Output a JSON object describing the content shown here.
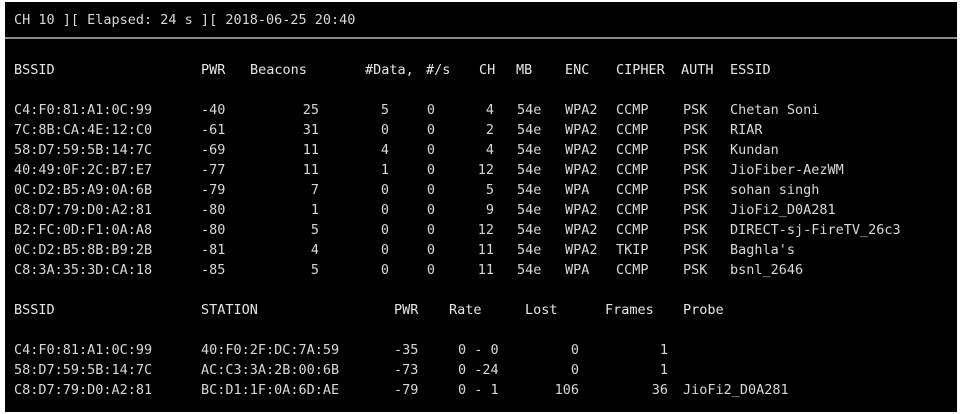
{
  "header": {
    "status_line": "CH 10 ][ Elapsed: 24 s ][ 2018-06-25 20:40"
  },
  "ap_table": {
    "headers": {
      "bssid": "BSSID",
      "pwr": "PWR",
      "beacons": "Beacons",
      "data": "#Data,",
      "rate": "#/s",
      "ch": "CH",
      "mb": "MB",
      "enc": "ENC",
      "cipher": "CIPHER",
      "auth": "AUTH",
      "essid": "ESSID"
    },
    "rows": [
      {
        "bssid": "C4:F0:81:A1:0C:99",
        "pwr": "-40",
        "beacons": "25",
        "data": "5",
        "rate": "0",
        "ch": "4",
        "mb": "54e",
        "enc": "WPA2",
        "cipher": "CCMP",
        "auth": "PSK",
        "essid": "Chetan Soni"
      },
      {
        "bssid": "7C:8B:CA:4E:12:C0",
        "pwr": "-61",
        "beacons": "31",
        "data": "0",
        "rate": "0",
        "ch": "2",
        "mb": "54e",
        "enc": "WPA2",
        "cipher": "CCMP",
        "auth": "PSK",
        "essid": "RIAR"
      },
      {
        "bssid": "58:D7:59:5B:14:7C",
        "pwr": "-69",
        "beacons": "11",
        "data": "4",
        "rate": "0",
        "ch": "4",
        "mb": "54e",
        "enc": "WPA2",
        "cipher": "CCMP",
        "auth": "PSK",
        "essid": "Kundan"
      },
      {
        "bssid": "40:49:0F:2C:B7:E7",
        "pwr": "-77",
        "beacons": "11",
        "data": "1",
        "rate": "0",
        "ch": "12",
        "mb": "54e",
        "enc": "WPA2",
        "cipher": "CCMP",
        "auth": "PSK",
        "essid": "JioFiber-AezWM"
      },
      {
        "bssid": "0C:D2:B5:A9:0A:6B",
        "pwr": "-79",
        "beacons": "7",
        "data": "0",
        "rate": "0",
        "ch": "5",
        "mb": "54e",
        "enc": "WPA",
        "cipher": "CCMP",
        "auth": "PSK",
        "essid": "sohan singh"
      },
      {
        "bssid": "C8:D7:79:D0:A2:81",
        "pwr": "-80",
        "beacons": "1",
        "data": "0",
        "rate": "0",
        "ch": "9",
        "mb": "54e",
        "enc": "WPA2",
        "cipher": "CCMP",
        "auth": "PSK",
        "essid": "JioFi2_D0A281"
      },
      {
        "bssid": "B2:FC:0D:F1:0A:A8",
        "pwr": "-80",
        "beacons": "5",
        "data": "0",
        "rate": "0",
        "ch": "12",
        "mb": "54e",
        "enc": "WPA2",
        "cipher": "CCMP",
        "auth": "PSK",
        "essid": "DIRECT-sj-FireTV_26c3"
      },
      {
        "bssid": "0C:D2:B5:8B:B9:2B",
        "pwr": "-81",
        "beacons": "4",
        "data": "0",
        "rate": "0",
        "ch": "11",
        "mb": "54e",
        "enc": "WPA2",
        "cipher": "TKIP",
        "auth": "PSK",
        "essid": "Baghla's"
      },
      {
        "bssid": "C8:3A:35:3D:CA:18",
        "pwr": "-85",
        "beacons": "5",
        "data": "0",
        "rate": "0",
        "ch": "11",
        "mb": "54e",
        "enc": "WPA",
        "cipher": "CCMP",
        "auth": "PSK",
        "essid": "bsnl_2646"
      }
    ]
  },
  "station_table": {
    "headers": {
      "bssid": "BSSID",
      "station": "STATION",
      "pwr": "PWR",
      "rate": "Rate",
      "lost": "Lost",
      "frames": "Frames",
      "probe": "Probe"
    },
    "rows": [
      {
        "bssid": "C4:F0:81:A1:0C:99",
        "station": "40:F0:2F:DC:7A:59",
        "pwr": "-35",
        "rate": "0 - 0",
        "lost": "0",
        "frames": "1",
        "probe": ""
      },
      {
        "bssid": "58:D7:59:5B:14:7C",
        "station": "AC:C3:3A:2B:00:6B",
        "pwr": "-73",
        "rate": "0 -24",
        "lost": "0",
        "frames": "1",
        "probe": ""
      },
      {
        "bssid": "C8:D7:79:D0:A2:81",
        "station": "BC:D1:1F:0A:6D:AE",
        "pwr": "-79",
        "rate": "0 - 1",
        "lost": "106",
        "frames": "36",
        "probe": "JioFi2_D0A281"
      }
    ]
  }
}
